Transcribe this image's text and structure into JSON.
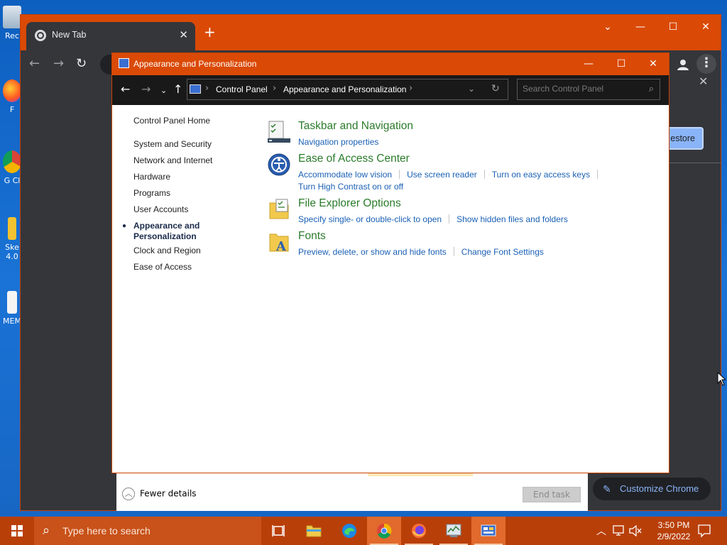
{
  "desktop": {
    "icons": [
      {
        "name": "recycle-bin",
        "label": "Rec"
      },
      {
        "name": "firefox",
        "label": "F"
      },
      {
        "name": "google-chrome",
        "label": "G Cl"
      },
      {
        "name": "sketchup",
        "label": "Ske 4.0"
      },
      {
        "name": "memo",
        "label": "MEM"
      }
    ]
  },
  "chrome": {
    "tab_title": "New Tab",
    "tab_close": "✕",
    "new_tab": "+",
    "minimize": "—",
    "maximize": "☐",
    "close": "✕",
    "tab_search": "⌄",
    "menu": "⋮",
    "restore_label": "estore",
    "customize_label": "Customize Chrome",
    "infobar_close": "✕"
  },
  "control_panel": {
    "title": "Appearance and Personalization",
    "breadcrumbs": [
      "Control Panel",
      "Appearance and Personalization"
    ],
    "search_placeholder": "Search Control Panel",
    "sidebar": [
      {
        "label": "Control Panel Home",
        "active": false
      },
      {
        "label": "System and Security",
        "active": false
      },
      {
        "label": "Network and Internet",
        "active": false
      },
      {
        "label": "Hardware",
        "active": false
      },
      {
        "label": "Programs",
        "active": false
      },
      {
        "label": "User Accounts",
        "active": false
      },
      {
        "label": "Appearance and Personalization",
        "active": true
      },
      {
        "label": "Clock and Region",
        "active": false
      },
      {
        "label": "Ease of Access",
        "active": false
      }
    ],
    "categories": [
      {
        "title": "Taskbar and Navigation",
        "icon": "taskbar-icon",
        "links": [
          "Navigation properties"
        ]
      },
      {
        "title": "Ease of Access Center",
        "icon": "ease-of-access-icon",
        "links": [
          "Accommodate low vision",
          "Use screen reader",
          "Turn on easy access keys",
          "Turn High Contrast on or off"
        ]
      },
      {
        "title": "File Explorer Options",
        "icon": "folder-options-icon",
        "links": [
          "Specify single- or double-click to open",
          "Show hidden files and folders"
        ]
      },
      {
        "title": "Fonts",
        "icon": "fonts-folder-icon",
        "links": [
          "Preview, delete, or show and hide fonts",
          "Change Font Settings"
        ]
      }
    ]
  },
  "task_manager": {
    "fewer_details": "Fewer details",
    "end_task": "End task"
  },
  "taskbar": {
    "search_placeholder": "Type here to search",
    "clock_time": "3:50 PM",
    "clock_date": "2/9/2022",
    "apps": [
      "task-view",
      "file-explorer",
      "microsoft-edge",
      "google-chrome",
      "firefox",
      "task-manager",
      "control-panel"
    ]
  },
  "colors": {
    "accent": "#da4a06",
    "taskbar": "#b93f09",
    "link_blue": "#1a60b5",
    "category_green": "#2b7b2b",
    "chrome_dark": "#35363a"
  }
}
